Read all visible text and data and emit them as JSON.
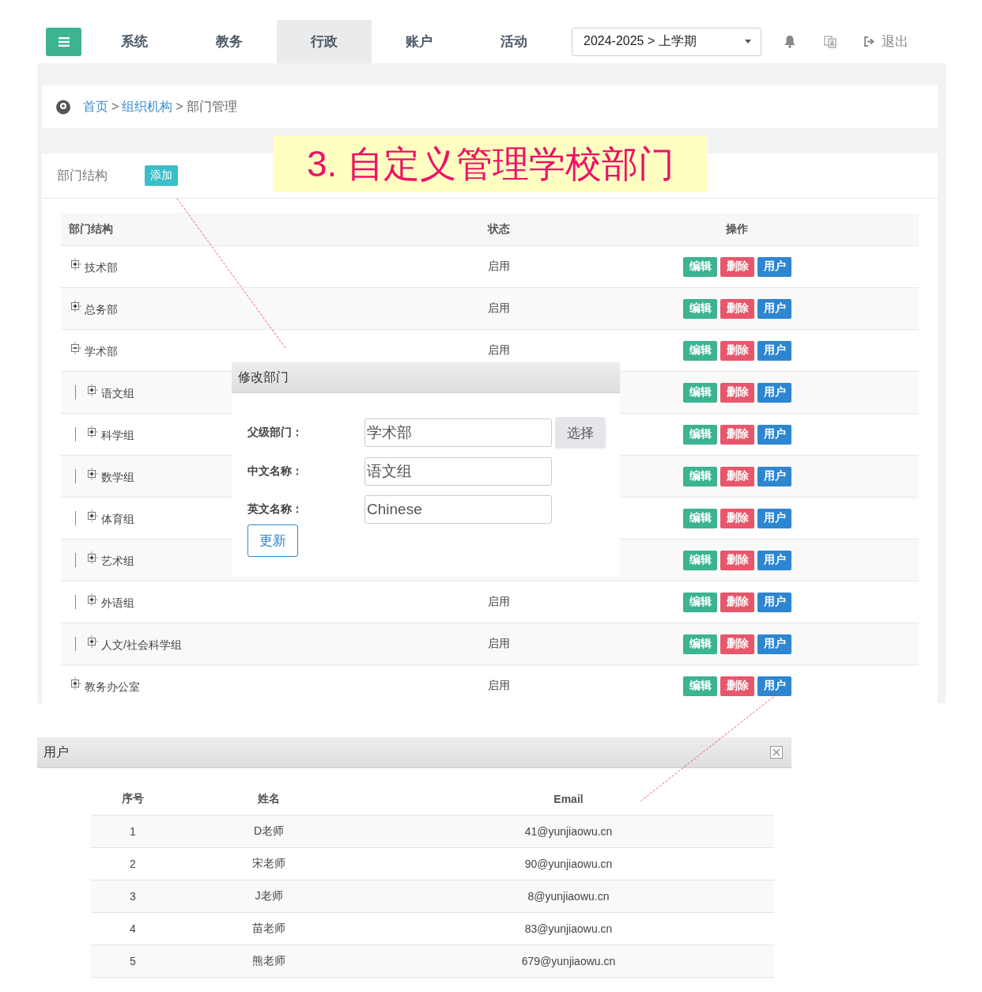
{
  "nav": {
    "tabs": [
      {
        "label": "系统",
        "selected": false
      },
      {
        "label": "教务",
        "selected": false
      },
      {
        "label": "行政",
        "selected": true
      },
      {
        "label": "账户",
        "selected": false
      },
      {
        "label": "活动",
        "selected": false
      }
    ],
    "term_select": {
      "value": "2024-2025 > 上学期"
    },
    "logout": "退出"
  },
  "breadcrumb": [
    {
      "text": "首页",
      "kind": "link"
    },
    {
      "text": ">",
      "kind": "text"
    },
    {
      "text": "组织机构",
      "kind": "link"
    },
    {
      "text": "> 部门管理",
      "kind": "text"
    }
  ],
  "callout": "3. 自定义管理学校部门",
  "dept_panel": {
    "title": "部门结构",
    "add_button": "添加",
    "columns": [
      "部门结构",
      "状态",
      "操作"
    ],
    "tree": [
      {
        "name": "技术部",
        "status": "启用",
        "expanded": false,
        "actions": [
          "编辑",
          "删除",
          "用户"
        ]
      },
      {
        "name": "总务部",
        "status": "启用",
        "expanded": false,
        "actions": [
          "编辑",
          "删除",
          "用户"
        ]
      },
      {
        "name": "学术部",
        "status": "启用",
        "expanded": true,
        "actions": [
          "编辑",
          "删除",
          "用户"
        ],
        "children": [
          {
            "name": "语文组",
            "expanded": false,
            "actions": [
              "编辑",
              "删除",
              "用户"
            ]
          },
          {
            "name": "科学组",
            "expanded": false,
            "actions": [
              "编辑",
              "删除",
              "用户"
            ]
          },
          {
            "name": "数学组",
            "expanded": false,
            "actions": [
              "编辑",
              "删除",
              "用户"
            ]
          },
          {
            "name": "体育组",
            "expanded": false,
            "actions": [
              "编辑",
              "删除",
              "用户"
            ]
          },
          {
            "name": "艺术组",
            "expanded": false,
            "actions": [
              "编辑",
              "删除",
              "用户"
            ]
          },
          {
            "name": "外语组",
            "status": "启用",
            "expanded": false,
            "actions": [
              "编辑",
              "删除",
              "用户"
            ]
          },
          {
            "name": "人文/社会科学组",
            "status": "启用",
            "expanded": false,
            "actions": [
              "编辑",
              "删除",
              "用户"
            ]
          }
        ]
      },
      {
        "name": "教务办公室",
        "status": "启用",
        "expanded": false,
        "actions": [
          "编辑",
          "删除",
          "用户"
        ]
      }
    ]
  },
  "edit_dialog": {
    "title": "修改部门",
    "fields": [
      {
        "label": "父级部门：",
        "value": "学术部",
        "button": "选择"
      },
      {
        "label": "中文名称：",
        "value": "语文组"
      },
      {
        "label": "英文名称：",
        "value": "Chinese"
      }
    ],
    "submit": "更新"
  },
  "users_dialog": {
    "title": "用户",
    "columns": [
      "序号",
      "姓名",
      "Email"
    ],
    "rows": [
      [
        "1",
        "D老师",
        "41@yunjiaowu.cn"
      ],
      [
        "2",
        "宋老师",
        "90@yunjiaowu.cn"
      ],
      [
        "3",
        "J老师",
        "8@yunjiaowu.cn"
      ],
      [
        "4",
        "苗老师",
        "83@yunjiaowu.cn"
      ],
      [
        "5",
        "熊老师",
        "679@yunjiaowu.cn"
      ]
    ]
  }
}
